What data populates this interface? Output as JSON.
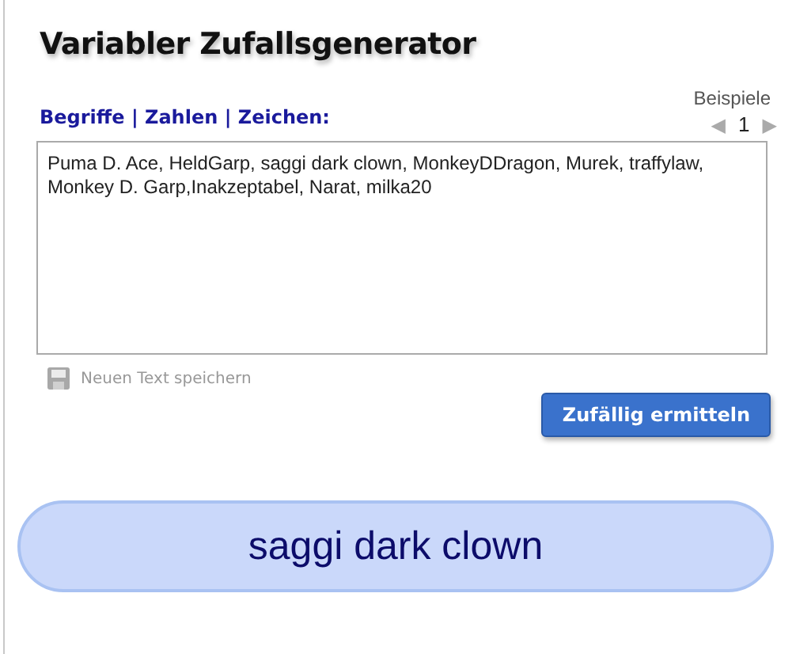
{
  "title": "Variabler Zufallsgenerator",
  "input_label": "Begriffe | Zahlen | Zeichen:",
  "examples": {
    "label": "Beispiele",
    "prev": "◀",
    "page": "1",
    "next": "▶"
  },
  "text_input": {
    "value": "Puma D. Ace, HeldGarp, saggi dark clown, MonkeyDDragon, Murek, traffylaw, Monkey D. Garp,Inakzeptabel, Narat, milka20"
  },
  "save_link": {
    "label": "Neuen Text speichern",
    "disabled": true
  },
  "buttons": [
    "Zufällig ermitteln"
  ],
  "result": "saggi dark clown"
}
